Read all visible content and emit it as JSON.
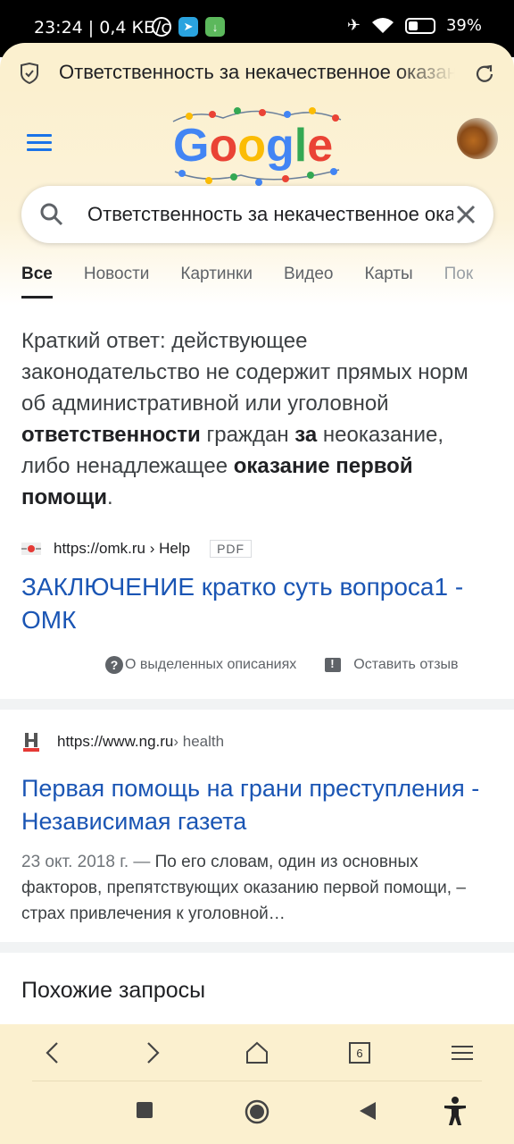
{
  "status_bar": {
    "time": "23:24 | 0,4 КБ/с",
    "battery_text": "39%",
    "battery_level": 0.39
  },
  "browser": {
    "url_title": "Ответственность за некачественное оказание",
    "tab_count": "6"
  },
  "search": {
    "query": "Ответственность за некачественное оказание"
  },
  "tabs": [
    {
      "label": "Все"
    },
    {
      "label": "Новости"
    },
    {
      "label": "Картинки"
    },
    {
      "label": "Видео"
    },
    {
      "label": "Карты"
    },
    {
      "label": "Пок"
    }
  ],
  "featured_snippet": {
    "text_1": "Краткий ответ: действующее законодательство не содержит прямых норм об административной или уголовной ",
    "bold_1": "ответственности",
    "text_2": " граждан ",
    "bold_2": "за",
    "text_3": " неоказание, либо ненадлежащее ",
    "bold_3": "оказание первой помощи",
    "text_4": ".",
    "source_url": "https://omk.ru › Help",
    "badge": "PDF",
    "title": "ЗАКЛЮЧЕНИЕ кратко суть вопроса1 - ОМК",
    "about_label": "О выделенных описаниях",
    "feedback_label": "Оставить отзыв"
  },
  "result_2": {
    "url": "https://www.ng.ru",
    "crumb": " › health",
    "title": "Первая помощь на грани преступления - Независимая газета",
    "date": "23 окт. 2018 г. —",
    "snippet": " По его словам, один из основных факторов, препятствующих оказанию первой помощи, – страх привлечения к уголовной…"
  },
  "related": {
    "title": "Похожие запросы"
  },
  "colors": {
    "chrome_bg": "#fbf0cf",
    "link": "#1a55b4",
    "google_blue": "#4285f4",
    "google_red": "#ea4335",
    "google_yellow": "#fbbc05",
    "google_green": "#34a853"
  }
}
